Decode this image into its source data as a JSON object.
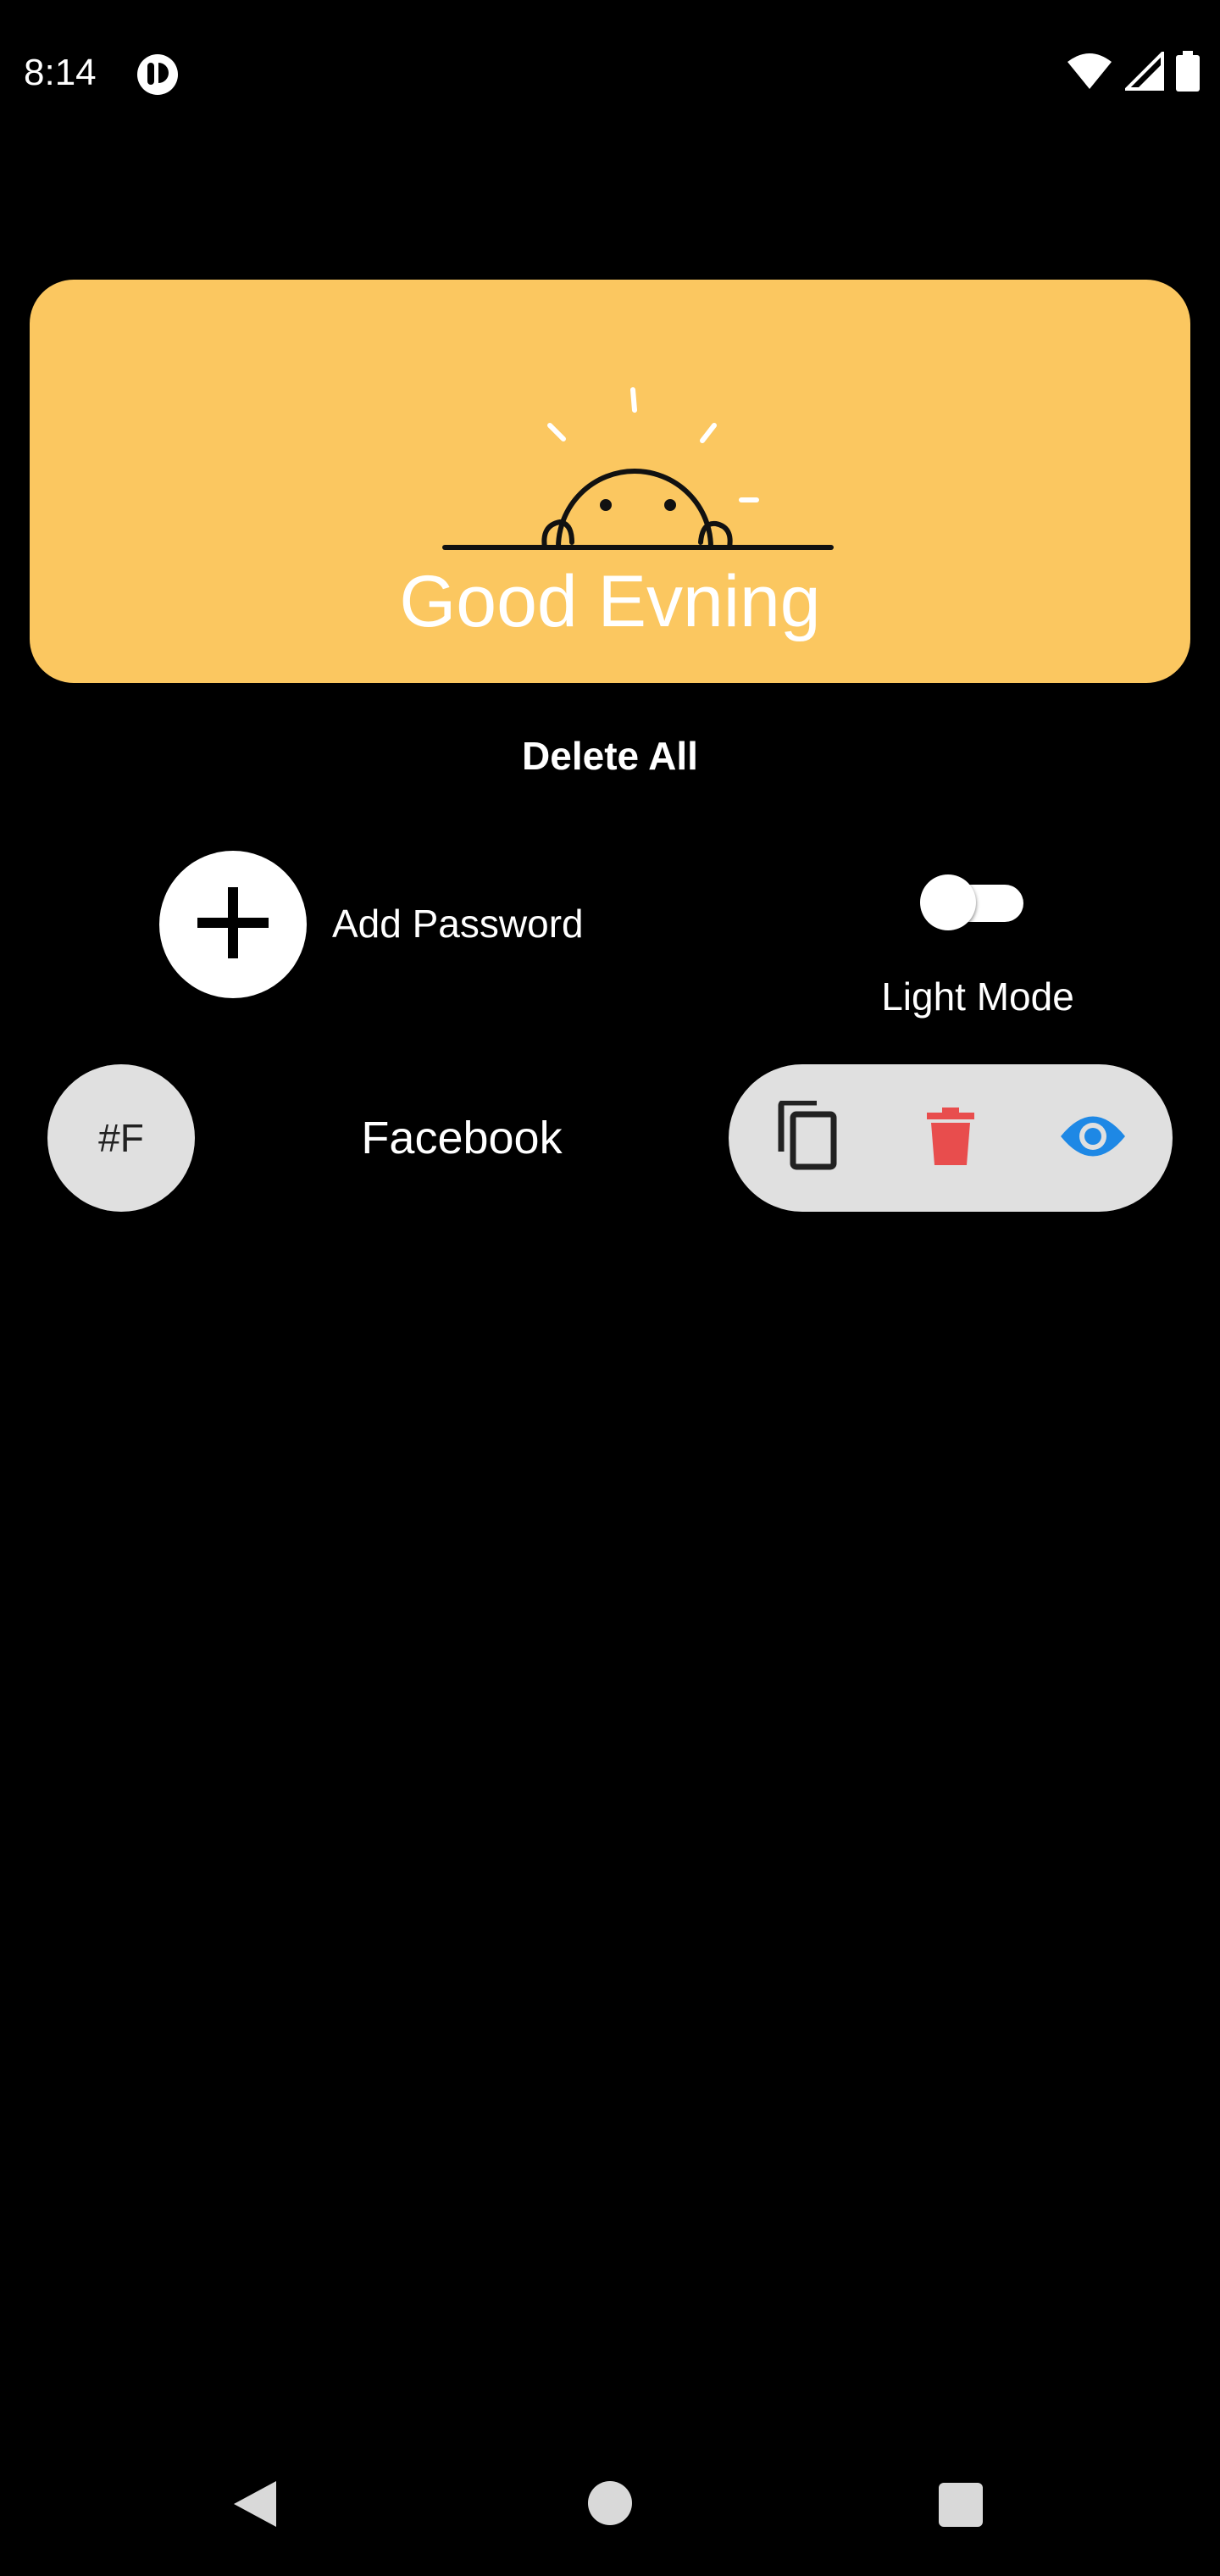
{
  "status_bar": {
    "time": "8:14",
    "icons": [
      "app-notification-icon",
      "wifi-icon",
      "cellular-signal-icon",
      "battery-icon"
    ]
  },
  "banner": {
    "greeting": "Good Evning",
    "illustration": "sunrise-smiley-illustration",
    "background_color": "#fbc760"
  },
  "actions": {
    "delete_all_label": "Delete All",
    "add_password_label": "Add Password",
    "add_icon": "plus-icon"
  },
  "theme_toggle": {
    "label": "Light Mode",
    "on": false
  },
  "entries": [
    {
      "avatar_text": "#F",
      "name": "Facebook",
      "actions": [
        {
          "icon": "copy-icon",
          "color": "#222222"
        },
        {
          "icon": "delete-icon",
          "color": "#e84d4d"
        },
        {
          "icon": "view-icon",
          "color": "#1e88e5"
        }
      ]
    }
  ],
  "nav_bar": {
    "icons": [
      "back-icon",
      "home-icon",
      "recents-icon"
    ]
  }
}
